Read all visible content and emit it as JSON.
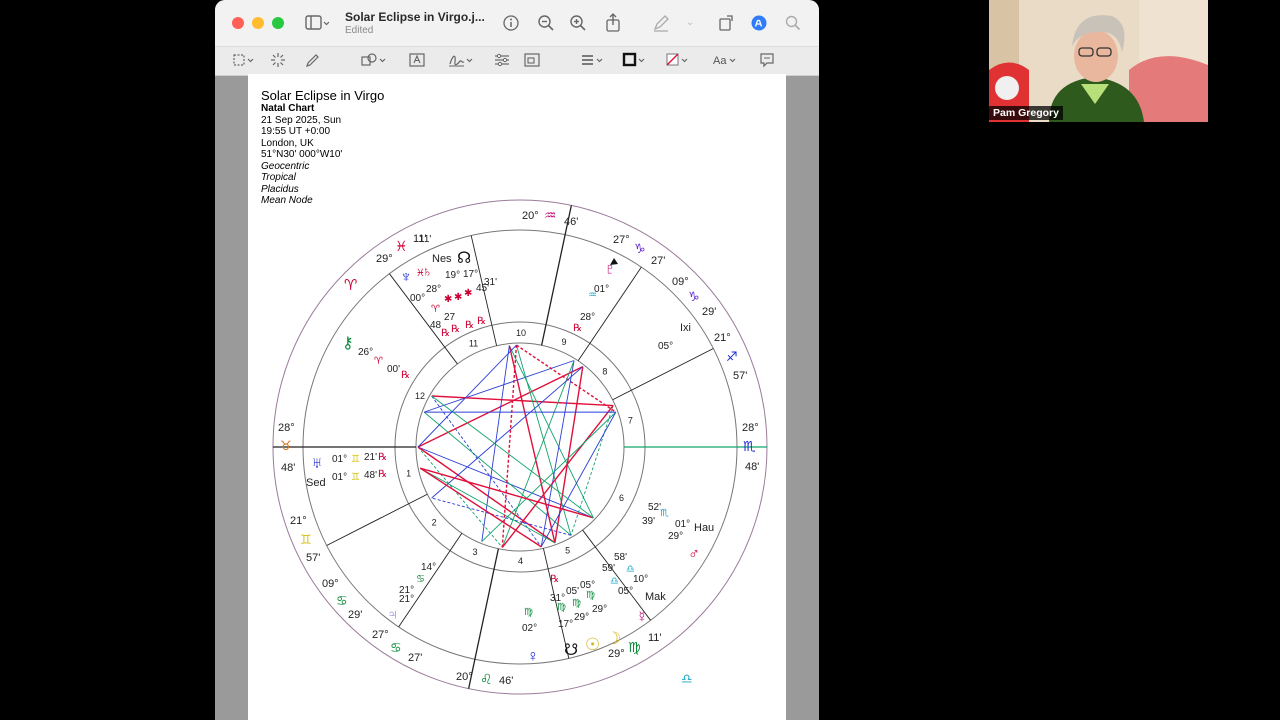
{
  "window": {
    "title": "Solar Eclipse in Virgo.j...",
    "subtitle": "Edited"
  },
  "chart_info": {
    "title": "Solar Eclipse in Virgo",
    "chart_type": "Natal Chart",
    "date": "21 Sep 2025, Sun",
    "time": "19:55  UT +0:00",
    "place": "London, UK",
    "coords": "51°N30' 000°W10'",
    "settings": [
      "Geocentric",
      "Tropical",
      "Placidus",
      "Mean Node"
    ]
  },
  "wheel": {
    "house_numbers": [
      "1",
      "2",
      "3",
      "4",
      "5",
      "6",
      "7",
      "8",
      "9",
      "10",
      "11",
      "12"
    ],
    "cusps": [
      {
        "id": "mc",
        "deg": "20°",
        "min": "46'",
        "sign": "♒"
      },
      {
        "id": "ic",
        "deg": "20°",
        "min": "46'",
        "sign": "♌"
      },
      {
        "id": "asc",
        "deg": "28°",
        "min": "48'",
        "sign": "♉"
      },
      {
        "id": "dsc",
        "deg": "28°",
        "min": "48'",
        "sign": "♏"
      },
      {
        "id": "c11",
        "deg": "27°",
        "min": "27'",
        "sign": "♑"
      },
      {
        "id": "c12",
        "deg": "09°",
        "min": "29'",
        "sign": "♑"
      },
      {
        "id": "c2",
        "deg": "21°",
        "min": "57'",
        "sign": "♊"
      },
      {
        "id": "c3",
        "deg": "09°",
        "min": "29'",
        "sign": "♋"
      },
      {
        "id": "c4",
        "deg": "27°",
        "min": "27'",
        "sign": "♋"
      },
      {
        "id": "c8",
        "deg": "21°",
        "min": "57'",
        "sign": "♐"
      },
      {
        "id": "c9",
        "deg": "29°",
        "min": "11'",
        "sign": "♍"
      },
      {
        "id": "c10",
        "deg": "29°",
        "min": "11'",
        "sign": "♓"
      }
    ],
    "bodies": [
      {
        "name": "Neptune",
        "glyph": "♆",
        "label": "00°"
      },
      {
        "name": "Nessus",
        "glyph": "Nes"
      },
      {
        "name": "North Node",
        "glyph": "☊",
        "label": "17°"
      },
      {
        "name": "Saturn",
        "glyph": "♄",
        "label": "28°"
      },
      {
        "name": "Pluto",
        "glyph": "♇",
        "label": "01°"
      },
      {
        "name": "Ixion",
        "glyph": "Ixi",
        "label": "05°"
      },
      {
        "name": "Chiron",
        "glyph": "⚷",
        "label": "26°"
      },
      {
        "name": "Uranus",
        "glyph": "♅",
        "label": "01°"
      },
      {
        "name": "Sedna",
        "glyph": "Sed",
        "label": "01°"
      },
      {
        "name": "Jupiter",
        "glyph": "♃",
        "label": "21°"
      },
      {
        "name": "Venus",
        "glyph": "♀",
        "label": "02°"
      },
      {
        "name": "South Node",
        "glyph": "☋",
        "label": "17°"
      },
      {
        "name": "Sun",
        "glyph": "☉",
        "label": "29°"
      },
      {
        "name": "Moon",
        "glyph": "☽",
        "label": "29°"
      },
      {
        "name": "Mercury",
        "glyph": "☿",
        "label": "05°"
      },
      {
        "name": "Makemake",
        "glyph": "Mak",
        "label": "10°"
      },
      {
        "name": "Mars",
        "glyph": "♂",
        "label": "01°"
      },
      {
        "name": "Haumea",
        "glyph": "Hau",
        "label": "29°"
      }
    ],
    "extra_labels": [
      "19°",
      "45'",
      "31'",
      "48",
      "27",
      "11'",
      "00'",
      "48'",
      "21'",
      "28°",
      "58'",
      "59'",
      "52'",
      "39'",
      "14°",
      "21°",
      "31°",
      "05'",
      "05°"
    ]
  },
  "video": {
    "name": "Pam Gregory"
  },
  "colors": {
    "red_aspect": "#e0103c",
    "blue_aspect": "#2b3ed6",
    "green_aspect": "#11a36c",
    "glyph_red": "#cc0033",
    "glyph_blue": "#1c2bd1",
    "glyph_green": "#0a8a3a"
  }
}
